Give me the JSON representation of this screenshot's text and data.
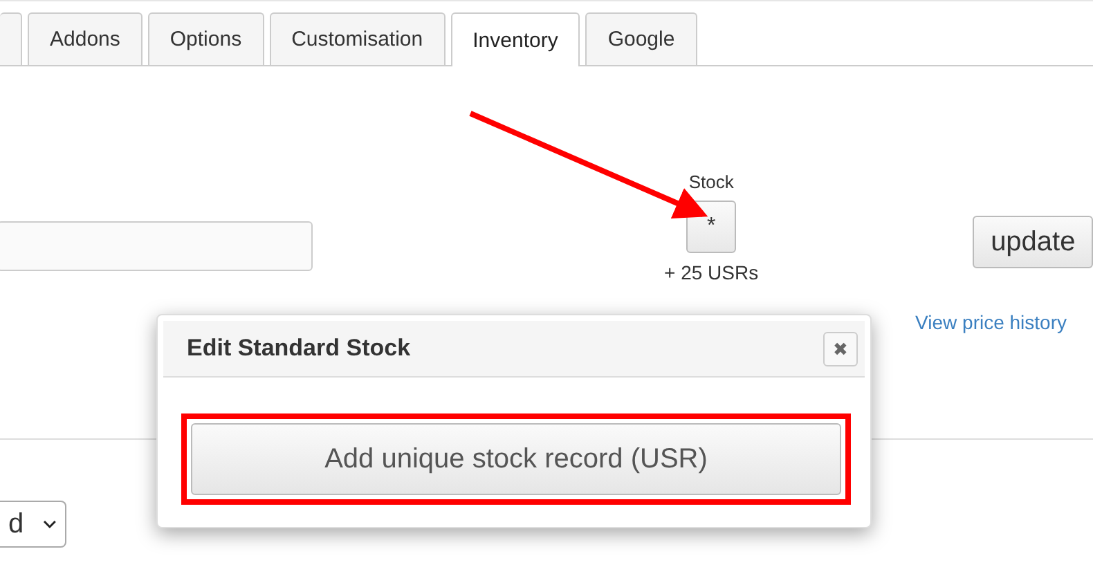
{
  "tabs": [
    {
      "label": "Addons",
      "selected": false
    },
    {
      "label": "Options",
      "selected": false
    },
    {
      "label": "Customisation",
      "selected": false
    },
    {
      "label": "Inventory",
      "selected": true
    },
    {
      "label": "Google",
      "selected": false
    }
  ],
  "stock": {
    "label": "Stock",
    "button": "*",
    "note": "+ 25 USRs"
  },
  "update_button": "update",
  "price_history_link": "View price history",
  "select": {
    "value": "d"
  },
  "dialog": {
    "title": "Edit Standard Stock",
    "close": "✖",
    "action": "Add unique stock record (USR)",
    "highlighted": true
  }
}
